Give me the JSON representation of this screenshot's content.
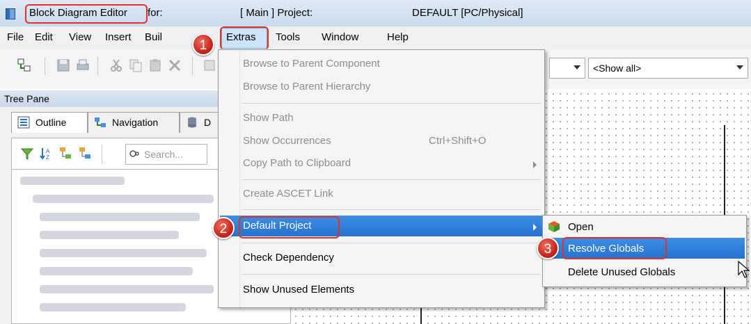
{
  "window": {
    "title_app": "Block Diagram Editor",
    "title_for": "for:",
    "title_main": "[ Main ] Project:",
    "title_default": "DEFAULT [PC/Physical]"
  },
  "menubar": {
    "items": [
      "File",
      "Edit",
      "View",
      "Insert",
      "Buil",
      "Extras",
      "Tools",
      "Window",
      "Help"
    ]
  },
  "toolbar": {
    "combo_value": "<Show all>"
  },
  "tree_pane": {
    "title": "Tree Pane",
    "tabs": [
      "Outline",
      "Navigation",
      "D"
    ],
    "search_placeholder": "Search..."
  },
  "extras_menu": {
    "items": [
      {
        "label": "Browse to Parent Component"
      },
      {
        "label": "Browse to Parent Hierarchy"
      },
      {
        "label": "Show Path"
      },
      {
        "label": "Show Occurrences",
        "shortcut": "Ctrl+Shift+O"
      },
      {
        "label": "Copy Path to Clipboard"
      },
      {
        "label": "Create ASCET Link"
      },
      {
        "label": "Default Project"
      },
      {
        "label": "Check Dependency"
      },
      {
        "label": "Show Unused Elements"
      }
    ]
  },
  "default_project_submenu": {
    "items": [
      "Open",
      "Resolve Globals",
      "Delete Unused Globals"
    ]
  },
  "callouts": [
    "1",
    "2",
    "3"
  ],
  "colors": {
    "highlight": "#2a78d6",
    "callout": "#e0302a"
  }
}
